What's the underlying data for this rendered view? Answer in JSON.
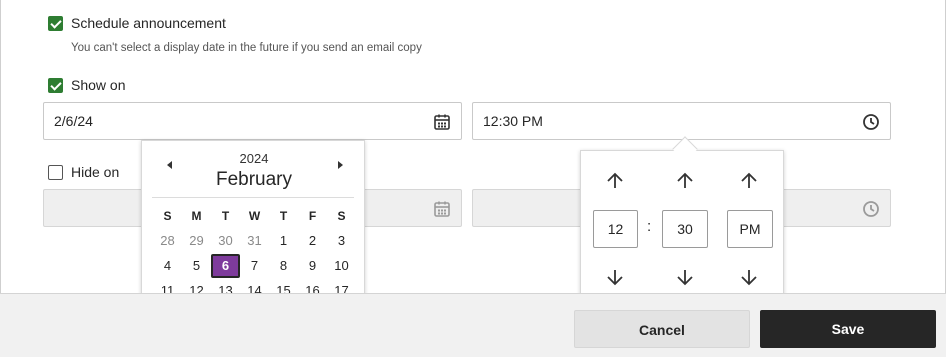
{
  "schedule": {
    "label": "Schedule announcement",
    "checked": true,
    "hint": "You can't select a display date in the future if you send an email copy"
  },
  "show_on": {
    "label": "Show on",
    "checked": true,
    "date_value": "2/6/24",
    "time_value": "12:30 PM",
    "date_icon": "calendar-icon",
    "time_icon": "clock-icon"
  },
  "hide_on": {
    "label": "Hide on",
    "checked": false,
    "date_value": "",
    "time_value": ""
  },
  "calendar": {
    "year": "2024",
    "month": "February",
    "prev_icon": "triangle-left-icon",
    "next_icon": "triangle-right-icon",
    "weekdays": [
      "S",
      "M",
      "T",
      "W",
      "T",
      "F",
      "S"
    ],
    "weeks": [
      [
        "28",
        "29",
        "30",
        "31",
        "1",
        "2",
        "3"
      ],
      [
        "4",
        "5",
        "6",
        "7",
        "8",
        "9",
        "10"
      ],
      [
        "11",
        "12",
        "13",
        "14",
        "15",
        "16",
        "17"
      ]
    ],
    "selected_day": "6",
    "accent_color": "#7e3b9c"
  },
  "time_picker": {
    "hour": "12",
    "separator": ":",
    "minute": "30",
    "period": "PM",
    "up_icon": "arrow-up-icon",
    "down_icon": "arrow-down-icon"
  },
  "footer": {
    "cancel_label": "Cancel",
    "save_label": "Save"
  },
  "colors": {
    "checkbox_green": "#2e7d32",
    "primary_button": "#262626"
  }
}
